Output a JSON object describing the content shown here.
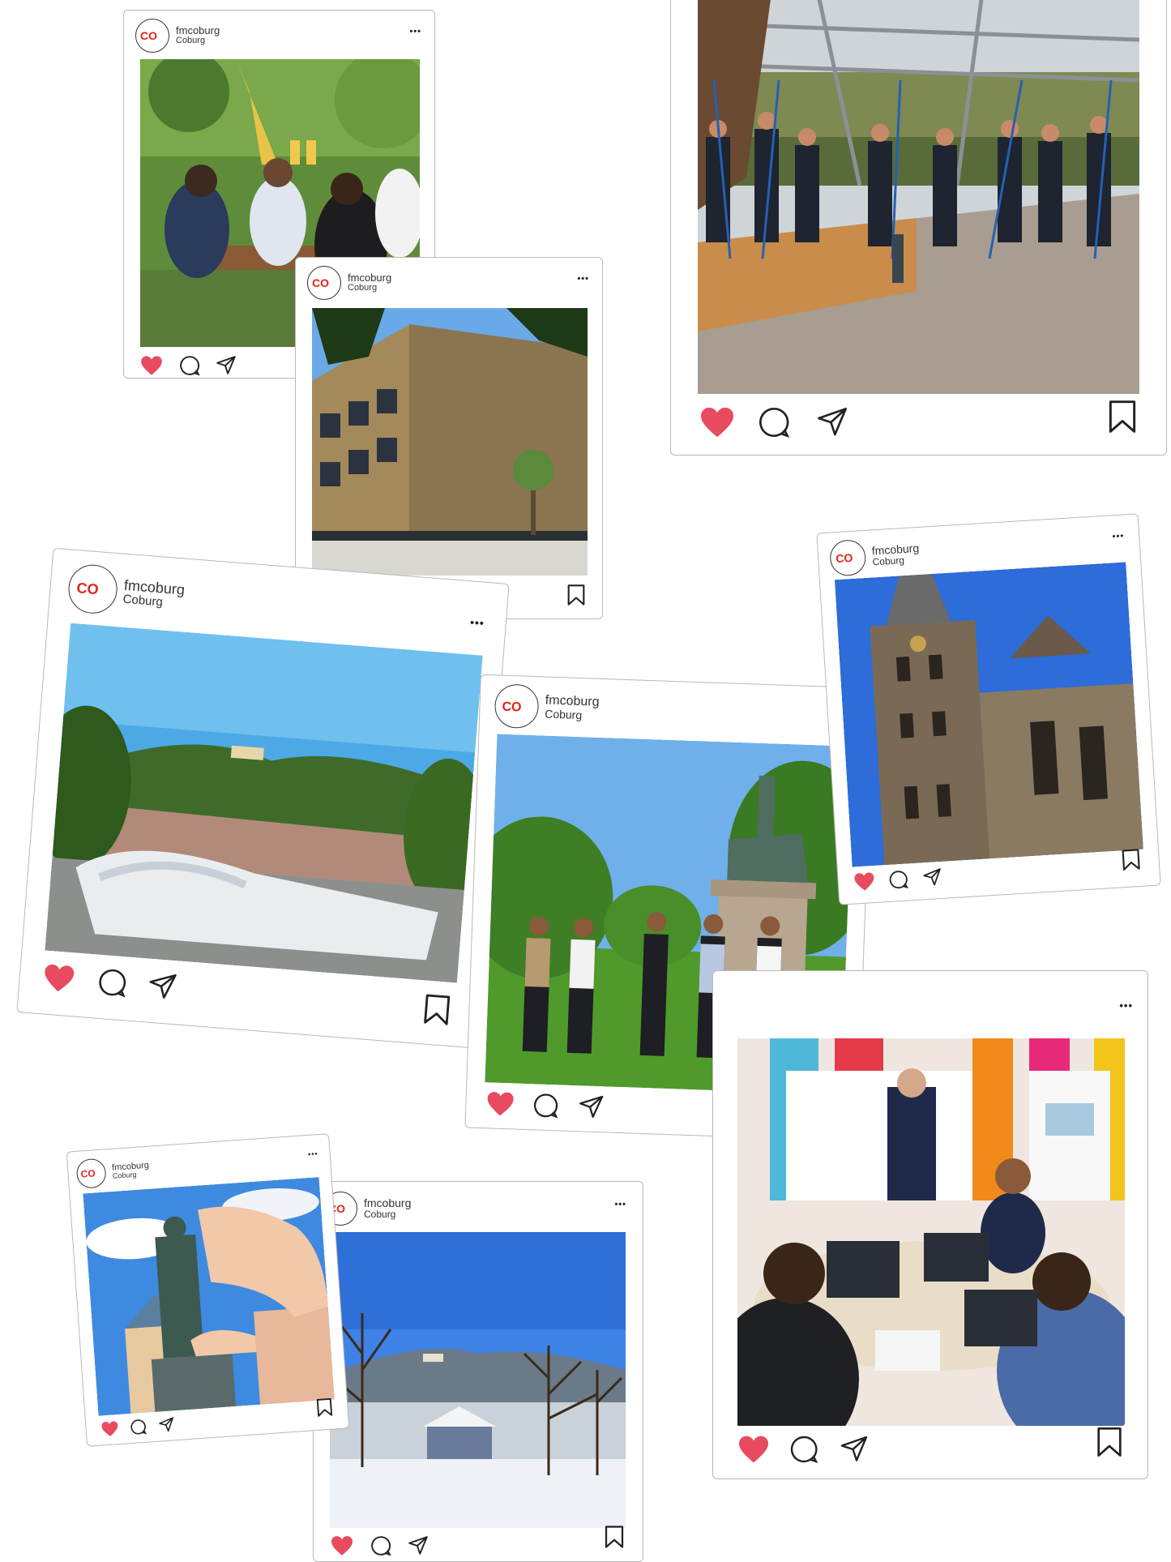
{
  "account": {
    "username": "fmcoburg",
    "location": "Coburg",
    "logo_text": "CO",
    "brand_color": "#e2231a"
  },
  "colors": {
    "like": "#e84a5f",
    "icon_stroke": "#222222",
    "border": "#b8b8b8"
  },
  "icons": [
    "heart-icon",
    "comment-icon",
    "share-icon",
    "bookmark-icon",
    "more-icon"
  ],
  "more_label": "•••",
  "posts": [
    {
      "id": "beer-garden",
      "photo": "Students toasting at a beer garden"
    },
    {
      "id": "building",
      "photo": "Modern campus building with bronze facade"
    },
    {
      "id": "high-ropes",
      "photo": "Group in climbing harnesses at a high ropes course"
    },
    {
      "id": "castle-view",
      "photo": "Open book with Veste Coburg on the hill"
    },
    {
      "id": "statue-walk",
      "photo": "Students walking on lawn near equestrian statue"
    },
    {
      "id": "church",
      "photo": "Gothic church towers against blue sky"
    },
    {
      "id": "prince-statue",
      "photo": "Hand holding Prince Albert statue"
    },
    {
      "id": "winter",
      "photo": "Snowy Coburg with castle in distance"
    },
    {
      "id": "classroom",
      "photo": "Lecturer presenting to students at table"
    }
  ]
}
